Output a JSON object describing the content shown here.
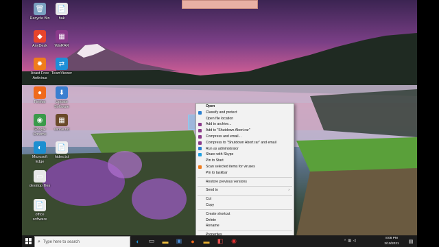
{
  "desktop": {
    "icons": [
      {
        "label": "Recycle Bin",
        "glyph": "🗑",
        "color": "#7aa0c0"
      },
      {
        "label": "hak",
        "glyph": "📄",
        "color": "#e8e8e8"
      },
      {
        "label": "AnyDesk",
        "glyph": "◆",
        "color": "#e8442c"
      },
      {
        "label": "WinRAR",
        "glyph": "▦",
        "color": "#8a3a8a"
      },
      {
        "label": "Avast Free\nAntivirus",
        "glyph": "✹",
        "color": "#f07c1c"
      },
      {
        "label": "TeamViewer",
        "glyph": "⇄",
        "color": "#1f8fd8"
      },
      {
        "label": "Firefox",
        "glyph": "●",
        "color": "#f06a1c"
      },
      {
        "label": "Update\nSoftware",
        "glyph": "⬇",
        "color": "#3a7fd0"
      },
      {
        "label": "Google\nChrome",
        "glyph": "◉",
        "color": "#3a9a4a"
      },
      {
        "label": "winrar.txt",
        "glyph": "▦",
        "color": "#6a4a2a"
      },
      {
        "label": "Microsoft\nEdge",
        "glyph": "◐",
        "color": "#1d8fd0"
      },
      {
        "label": "hides.txt",
        "glyph": "📄",
        "color": "#eeeeee"
      },
      {
        "label": "desktop files",
        "glyph": "▭",
        "color": "#e8e8e8"
      },
      {
        "label": "office\nsoftware",
        "glyph": "📄",
        "color": "#eeeeee"
      }
    ]
  },
  "context_menu": {
    "items": [
      {
        "label": "Open",
        "bold": true,
        "icon_color": ""
      },
      {
        "label": "Classify and protect",
        "icon_color": "#2a7fd0"
      },
      {
        "label": "Open file location",
        "icon_color": ""
      },
      {
        "label": "Add to archive...",
        "icon_color": "#8a3a8a"
      },
      {
        "label": "Add to \"Shutdown Abort.rar\"",
        "icon_color": "#8a3a8a"
      },
      {
        "label": "Compress and email...",
        "icon_color": "#8a3a8a"
      },
      {
        "label": "Compress to \"Shutdown Abort.rar\" and email",
        "icon_color": "#8a3a8a"
      },
      {
        "label": "Run as administrator",
        "icon_color": "#2a7fd0"
      },
      {
        "label": "Share with Skype",
        "icon_color": "#1fa0e0"
      },
      {
        "label": "Pin to Start",
        "icon_color": ""
      },
      {
        "label": "Scan selected items for viruses",
        "icon_color": "#f07c1c"
      },
      {
        "label": "Pin to taskbar",
        "icon_color": ""
      },
      {
        "sep": true
      },
      {
        "label": "Restore previous versions",
        "icon_color": ""
      },
      {
        "sep": true
      },
      {
        "label": "Send to",
        "icon_color": "",
        "submenu": true
      },
      {
        "sep": true
      },
      {
        "label": "Cut",
        "icon_color": ""
      },
      {
        "label": "Copy",
        "icon_color": ""
      },
      {
        "sep": true
      },
      {
        "label": "Create shortcut",
        "icon_color": ""
      },
      {
        "label": "Delete",
        "icon_color": ""
      },
      {
        "label": "Rename",
        "icon_color": ""
      },
      {
        "sep": true
      },
      {
        "label": "Properties",
        "icon_color": ""
      }
    ]
  },
  "taskbar": {
    "search_placeholder": "Type here to search",
    "time": "8:08 PM",
    "date": "2/19/2021",
    "pinned": [
      {
        "name": "edge-icon",
        "glyph": "◐",
        "color": "#1d8fd0"
      },
      {
        "name": "task-view-icon",
        "glyph": "▭",
        "color": "#cccccc"
      },
      {
        "name": "file-explorer-icon",
        "glyph": "▬",
        "color": "#f0c040"
      },
      {
        "name": "store-icon",
        "glyph": "▣",
        "color": "#4a8ad0"
      },
      {
        "name": "firefox-icon",
        "glyph": "●",
        "color": "#f06a1c"
      },
      {
        "name": "explorer-folder-icon",
        "glyph": "▬",
        "color": "#e8b030"
      },
      {
        "name": "app-icon",
        "glyph": "◧",
        "color": "#e85050"
      },
      {
        "name": "screen-recorder-icon",
        "glyph": "◉",
        "color": "#e03030"
      }
    ]
  }
}
